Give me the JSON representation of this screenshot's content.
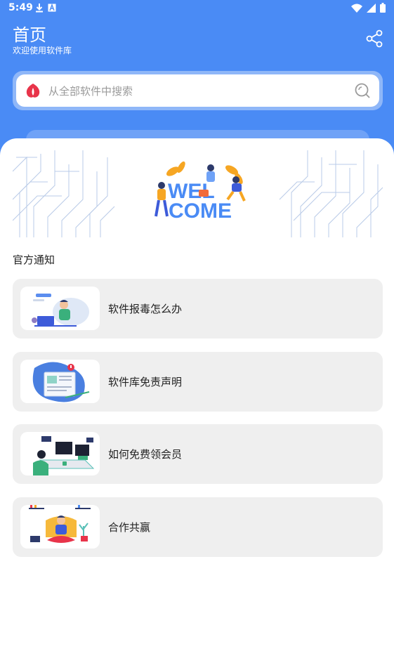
{
  "status_bar": {
    "time": "5:49",
    "left_icons": [
      "download-icon",
      "a-icon"
    ],
    "right_icons": [
      "wifi-icon",
      "signal-icon",
      "battery-icon"
    ]
  },
  "header": {
    "title": "首页",
    "subtitle": "欢迎使用软件库",
    "share_icon": "share-icon",
    "background_color": "#4a8bf5"
  },
  "search": {
    "placeholder": "从全部软件中搜索",
    "logo_icon": "app-logo-icon",
    "search_icon": "search-icon"
  },
  "banner": {
    "text_line1": "WEL",
    "text_line2": "COME"
  },
  "notices": {
    "section_title": "官方通知",
    "items": [
      {
        "label": "软件报毒怎么办",
        "thumb_icon": "person-at-laptop-illustration"
      },
      {
        "label": "软件库免责声明",
        "thumb_icon": "document-board-illustration"
      },
      {
        "label": "如何免费领会员",
        "thumb_icon": "person-at-monitors-illustration"
      },
      {
        "label": "合作共赢",
        "thumb_icon": "meditating-person-illustration"
      }
    ]
  }
}
